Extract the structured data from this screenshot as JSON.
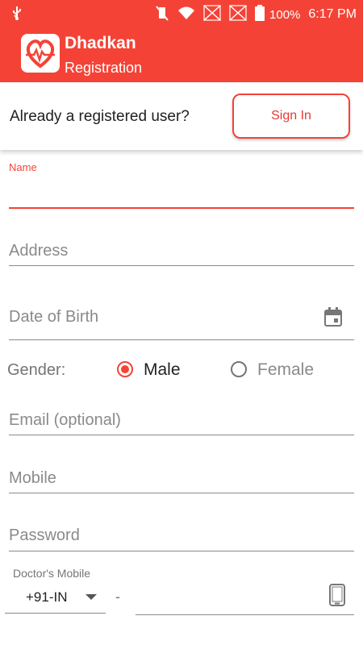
{
  "status_bar": {
    "battery": "100%",
    "time": "6:17 PM"
  },
  "app": {
    "title": "Dhadkan",
    "subtitle": "Registration",
    "accent": "#f44336"
  },
  "signin_card": {
    "prompt": "Already a registered user?",
    "button": "Sign In"
  },
  "form": {
    "name_label": "Name",
    "name_value": "",
    "address": "Address",
    "dob": "Date of Birth",
    "gender_label": "Gender:",
    "gender_options": [
      "Male",
      "Female"
    ],
    "gender_selected": "Male",
    "email": "Email (optional)",
    "mobile": "Mobile",
    "password": "Password",
    "doctor_mobile_label": "Doctor's Mobile",
    "country_code": "+91-IN",
    "separator": "-"
  }
}
